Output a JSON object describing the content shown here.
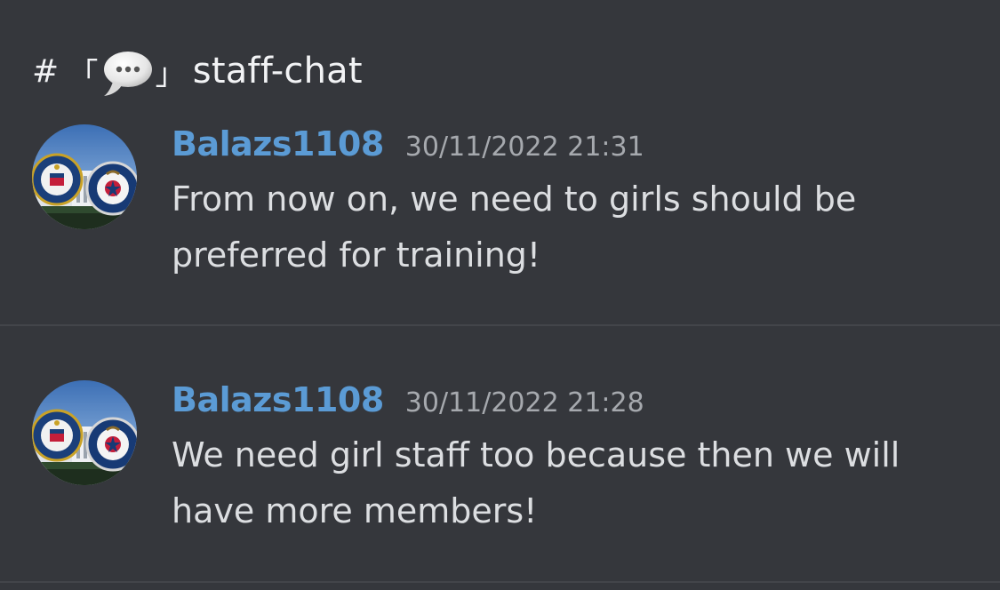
{
  "channel": {
    "hash": "#",
    "bracket_open": "「",
    "bracket_close": "」",
    "icon": "speech-bubble-icon",
    "name": "staff-chat"
  },
  "messages": [
    {
      "username": "Balazs1108",
      "timestamp": "30/11/2022 21:31",
      "text": "From now on, we need to girls should be preferred for training!",
      "avatar": "fbi-cia-seals-avatar"
    },
    {
      "username": "Balazs1108",
      "timestamp": "30/11/2022 21:28",
      "text": "We need girl staff too because then we will have more members!",
      "avatar": "fbi-cia-seals-avatar"
    }
  ],
  "colors": {
    "background": "#35373c",
    "username": "#5b9bd5",
    "text": "#dcdee1",
    "timestamp": "#a6a9ae",
    "divider": "#43454a"
  }
}
